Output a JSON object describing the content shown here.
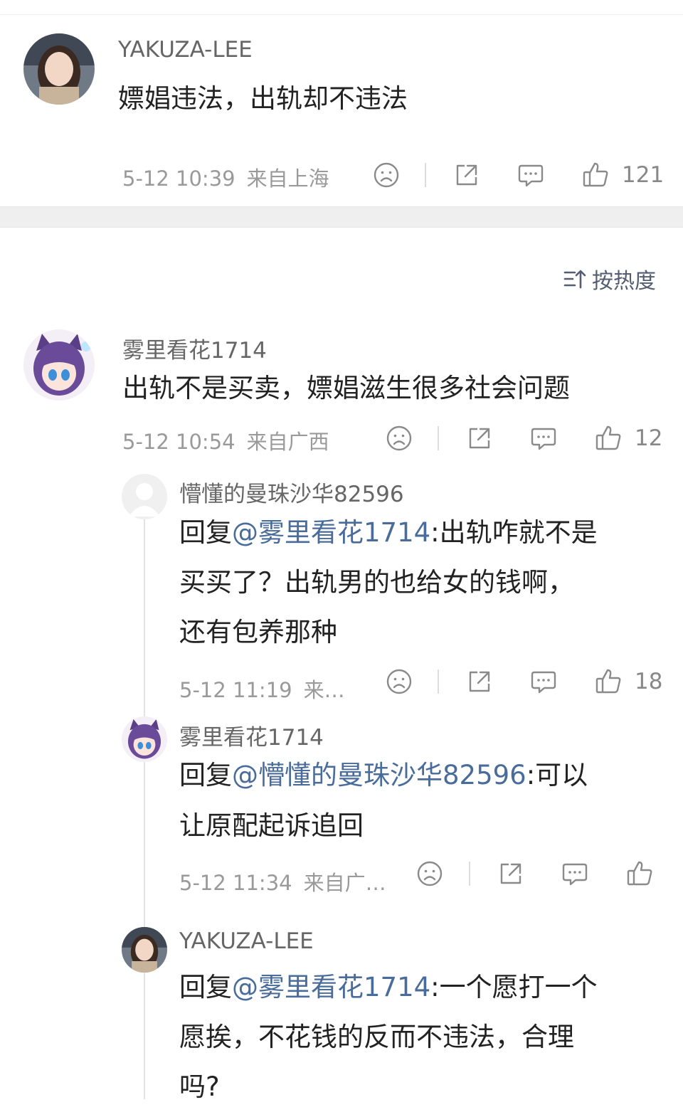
{
  "top_comment": {
    "username": "YAKUZA-LEE",
    "text": "嫖娼违法，出轨却不违法",
    "time": "5-12 10:39",
    "location": "来自上海",
    "likes": "121"
  },
  "sort": {
    "label": "按热度"
  },
  "comment": {
    "username": "雾里看花1714",
    "text": "出轨不是买卖，嫖娼滋生很多社会问题",
    "time": "5-12 10:54",
    "location": "来自广西",
    "likes": "12"
  },
  "replies": [
    {
      "username": "懵懂的曼珠沙华82596",
      "prefix": "回复",
      "mention": "@雾里看花1714",
      "line1_rest": ":出轨咋就不是",
      "line2": "买买了？出轨男的也给女的钱啊，",
      "line3": "还有包养那种",
      "time": "5-12 11:19",
      "location": "来…",
      "likes": "18"
    },
    {
      "username": "雾里看花1714",
      "prefix": "回复",
      "mention": "@懵懂的曼珠沙华82596",
      "line1_rest": ":可以",
      "line2": "让原配起诉追回",
      "time": "5-12 11:34",
      "location": "来自广…",
      "likes": ""
    },
    {
      "username": "YAKUZA-LEE",
      "prefix": "回复",
      "mention": "@雾里看花1714",
      "line1_rest": ":一个愿打一个",
      "line2": "愿挨，不花钱的反而不违法，合理",
      "line3": "吗?"
    }
  ],
  "icons": {
    "dislike": "frown-face-icon",
    "share": "share-icon",
    "reply": "comment-bubble-icon",
    "like": "thumbs-up-icon"
  },
  "colors": {
    "mention": "#4a6c9b",
    "meta": "#9a9a9a",
    "divider_band": "#efefef"
  }
}
